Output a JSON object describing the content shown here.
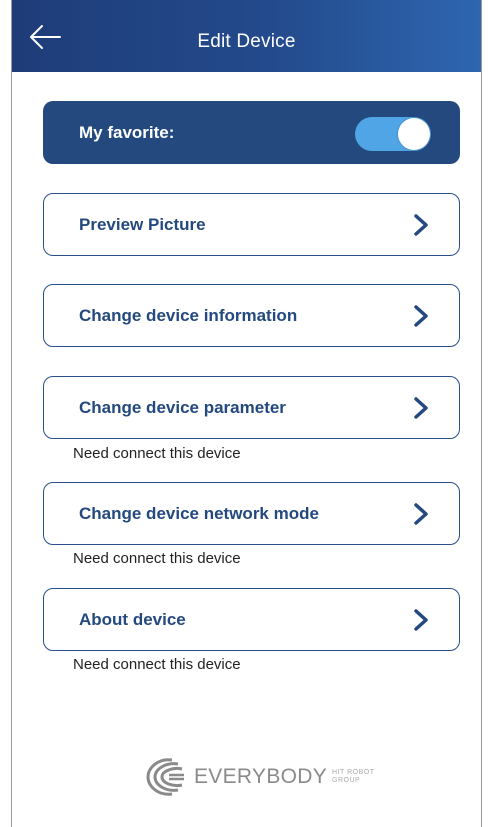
{
  "header": {
    "title": "Edit Device",
    "back_icon": "arrow-left-icon"
  },
  "favorite": {
    "label": "My favorite:",
    "enabled": true,
    "toggle_color": "#4fa5e6"
  },
  "menu": {
    "items": [
      {
        "label": "Preview Picture",
        "hint": ""
      },
      {
        "label": "Change device information",
        "hint": ""
      },
      {
        "label": "Change device parameter",
        "hint": "Need connect this device"
      },
      {
        "label": "Change device network mode",
        "hint": "Need connect this device"
      },
      {
        "label": "About device",
        "hint": "Need connect this device"
      }
    ],
    "chevron_icon": "chevron-right-icon"
  },
  "footer": {
    "brand": "EVERYBODY",
    "sub_line1": "HIT ROBOT",
    "sub_line2": "GROUP"
  },
  "colors": {
    "header_start": "#1e3c78",
    "header_end": "#2e66b0",
    "primary": "#24497f",
    "toggle_on": "#4fa5e6"
  }
}
